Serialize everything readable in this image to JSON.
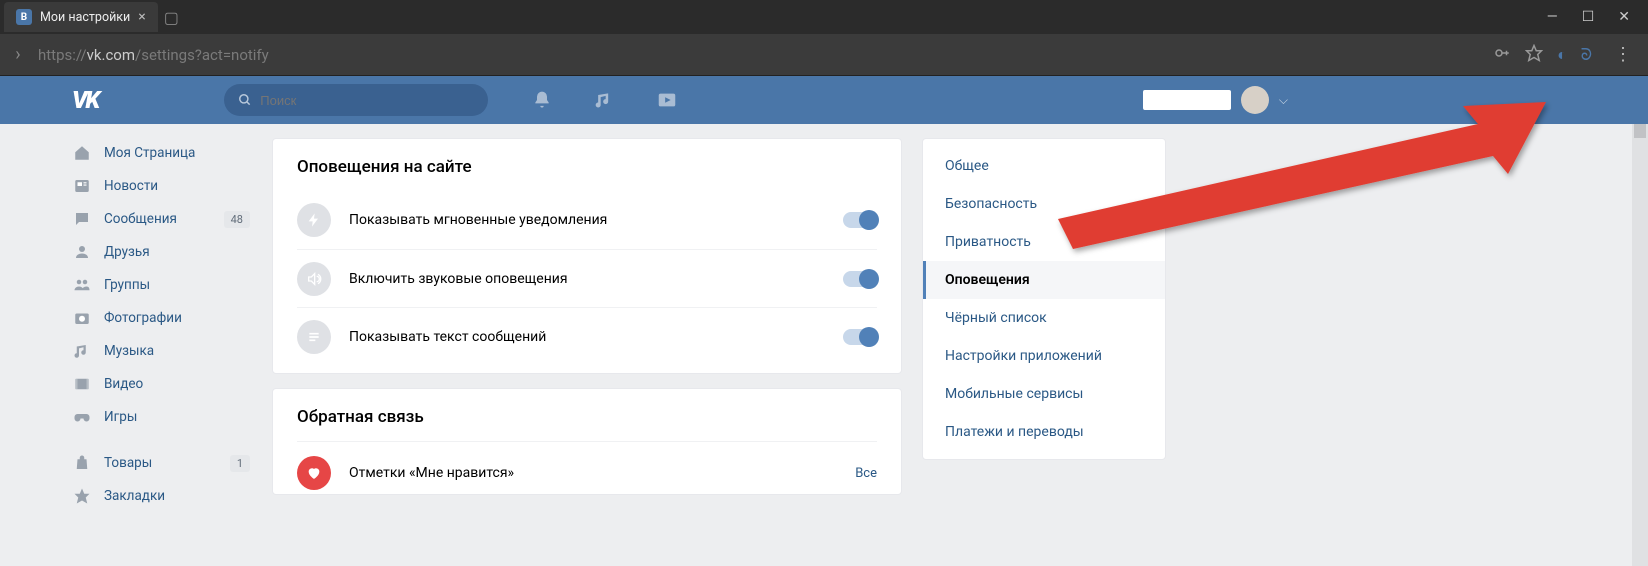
{
  "browser": {
    "tab_title": "Мои настройки",
    "url_full": "https://vk.com/settings?act=notify",
    "url_proto": "https://",
    "url_host": "vk.com",
    "url_path": "/settings?act=notify"
  },
  "header": {
    "search_placeholder": "Поиск"
  },
  "leftnav": {
    "items": [
      {
        "label": "Моя Страница"
      },
      {
        "label": "Новости"
      },
      {
        "label": "Сообщения",
        "badge": "48"
      },
      {
        "label": "Друзья"
      },
      {
        "label": "Группы"
      },
      {
        "label": "Фотографии"
      },
      {
        "label": "Музыка"
      },
      {
        "label": "Видео"
      },
      {
        "label": "Игры"
      }
    ],
    "lower": [
      {
        "label": "Товары",
        "badge": "1"
      },
      {
        "label": "Закладки"
      }
    ]
  },
  "main": {
    "card1_title": "Оповещения на сайте",
    "opts": [
      {
        "text": "Показывать мгновенные уведомления"
      },
      {
        "text": "Включить звуковые оповещения"
      },
      {
        "text": "Показывать текст сообщений"
      }
    ],
    "card2_title": "Обратная связь",
    "like_row": "Отметки «Мне нравится»",
    "all_label": "Все"
  },
  "settingsnav": {
    "items": [
      "Общее",
      "Безопасность",
      "Приватность",
      "Оповещения",
      "Чёрный список",
      "Настройки приложений",
      "Мобильные сервисы",
      "Платежи и переводы"
    ],
    "active_index": 3
  }
}
